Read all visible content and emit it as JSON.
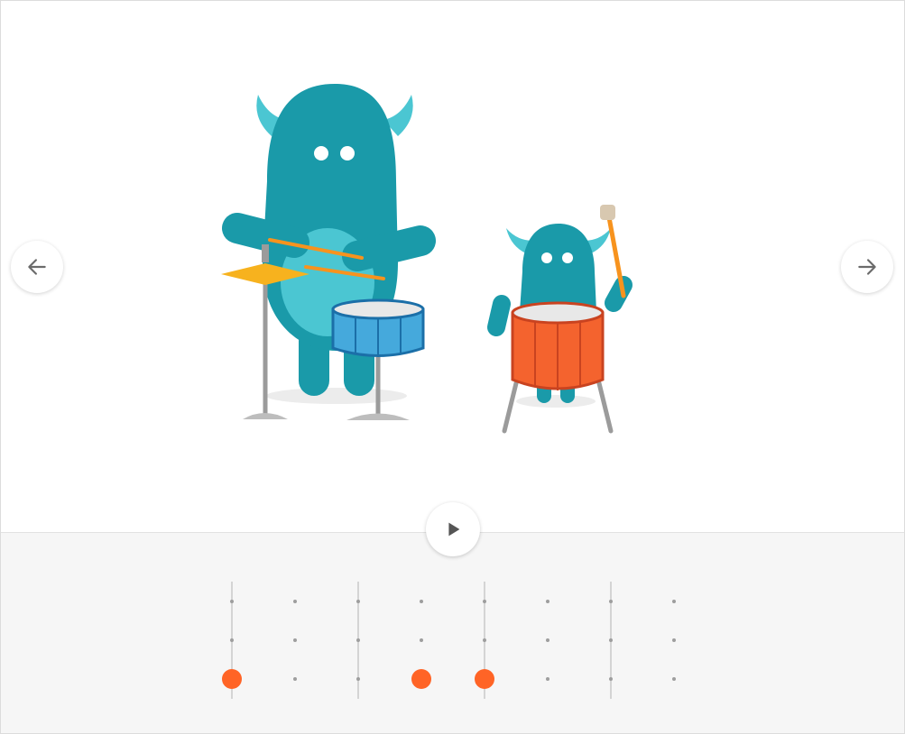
{
  "app": {
    "accent_color": "#ff6426",
    "background_color": "#ffffff",
    "sequencer_background": "#f6f6f6"
  },
  "navigation": {
    "prev_icon": "arrow-left-icon",
    "next_icon": "arrow-right-icon"
  },
  "playback": {
    "play_icon": "play-icon",
    "is_playing": false
  },
  "scene": {
    "characters": [
      {
        "name": "big-monster",
        "color": "#1a9aa9",
        "instruments": [
          "cymbal",
          "snare-drum"
        ]
      },
      {
        "name": "small-monster",
        "color": "#1a9aa9",
        "instruments": [
          "bass-drum"
        ]
      }
    ],
    "instrument_colors": {
      "cymbal": "#f7b21e",
      "snare-drum": "#45a9dc",
      "bass-drum": "#f4632e"
    }
  },
  "sequencer": {
    "steps": 8,
    "rows": 3,
    "beat_marker_steps": [
      0,
      2,
      4,
      6
    ],
    "active_notes": [
      {
        "row": 2,
        "step": 0
      },
      {
        "row": 2,
        "step": 3
      },
      {
        "row": 2,
        "step": 4
      }
    ]
  }
}
